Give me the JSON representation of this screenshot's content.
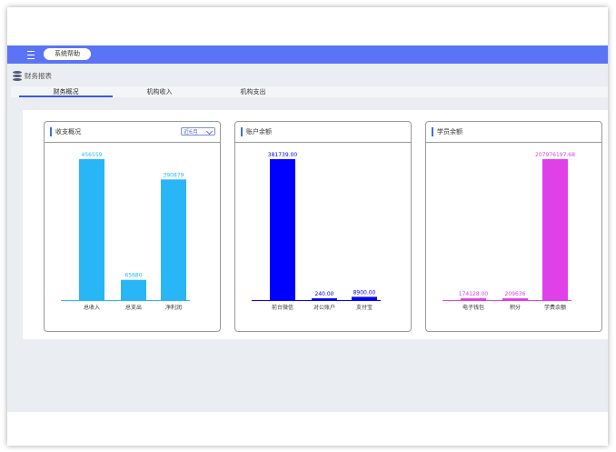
{
  "header": {
    "help_button": "系统帮助",
    "menu_icon": "hamburger-menu-icon"
  },
  "page": {
    "title": "财务报表",
    "title_icon": "database-icon"
  },
  "tabs": [
    {
      "label": "财务概况",
      "active": true
    },
    {
      "label": "机构收入",
      "active": false
    },
    {
      "label": "机构支出",
      "active": false
    }
  ],
  "cards": [
    {
      "title": "收支概况",
      "dropdown": "近6月"
    },
    {
      "title": "账户余额"
    },
    {
      "title": "学员余额"
    }
  ],
  "chart_data": [
    {
      "type": "bar",
      "categories": [
        "总收入",
        "总支出",
        "净利润"
      ],
      "values": [
        456559,
        65680,
        390879
      ],
      "value_labels": [
        "456559",
        "65680",
        "390879"
      ],
      "color": "#29b6f6",
      "ylim": [
        0,
        456559
      ]
    },
    {
      "type": "bar",
      "categories": [
        "前台微信",
        "对公账户",
        "支付宝"
      ],
      "values": [
        381739.0,
        240.0,
        8900.0
      ],
      "value_labels": [
        "381739.00",
        "240.00",
        "8900.00"
      ],
      "color": "#0000ff",
      "ylim": [
        0,
        381739
      ]
    },
    {
      "type": "bar",
      "categories": [
        "电子钱包",
        "积分",
        "学费余额"
      ],
      "values": [
        174128.0,
        209636,
        207976197.68
      ],
      "value_labels": [
        "174128.00",
        "209636",
        "207976197.68"
      ],
      "color": "#e040e8",
      "ylim": [
        0,
        207976197.68
      ]
    }
  ]
}
